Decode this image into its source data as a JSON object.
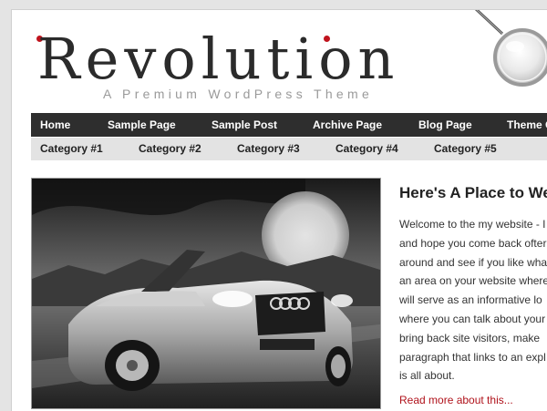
{
  "header": {
    "logo_text": "Revolution",
    "tagline": "A Premium WordPress Theme"
  },
  "nav": {
    "items": [
      {
        "label": "Home"
      },
      {
        "label": "Sample Page"
      },
      {
        "label": "Sample Post"
      },
      {
        "label": "Archive Page"
      },
      {
        "label": "Blog Page"
      },
      {
        "label": "Theme O"
      }
    ]
  },
  "categories": {
    "items": [
      {
        "label": "Category #1"
      },
      {
        "label": "Category #2"
      },
      {
        "label": "Category #3"
      },
      {
        "label": "Category #4"
      },
      {
        "label": "Category #5"
      }
    ]
  },
  "post": {
    "title": "Here's A Place to We",
    "lines": [
      "Welcome to the my website - I",
      "and hope you come back ofter",
      "around and see if you like wha",
      "an area on your website where",
      "will serve as an informative lo",
      "where you can talk about your",
      "bring back site visitors, make",
      "paragraph that links to an expl",
      "is all about."
    ],
    "read_more": "Read more about this..."
  },
  "colors": {
    "nav_bg": "#2e2e2e",
    "subnav_bg": "#e3e3e3",
    "accent": "#c0131d",
    "link": "#b0121b"
  }
}
